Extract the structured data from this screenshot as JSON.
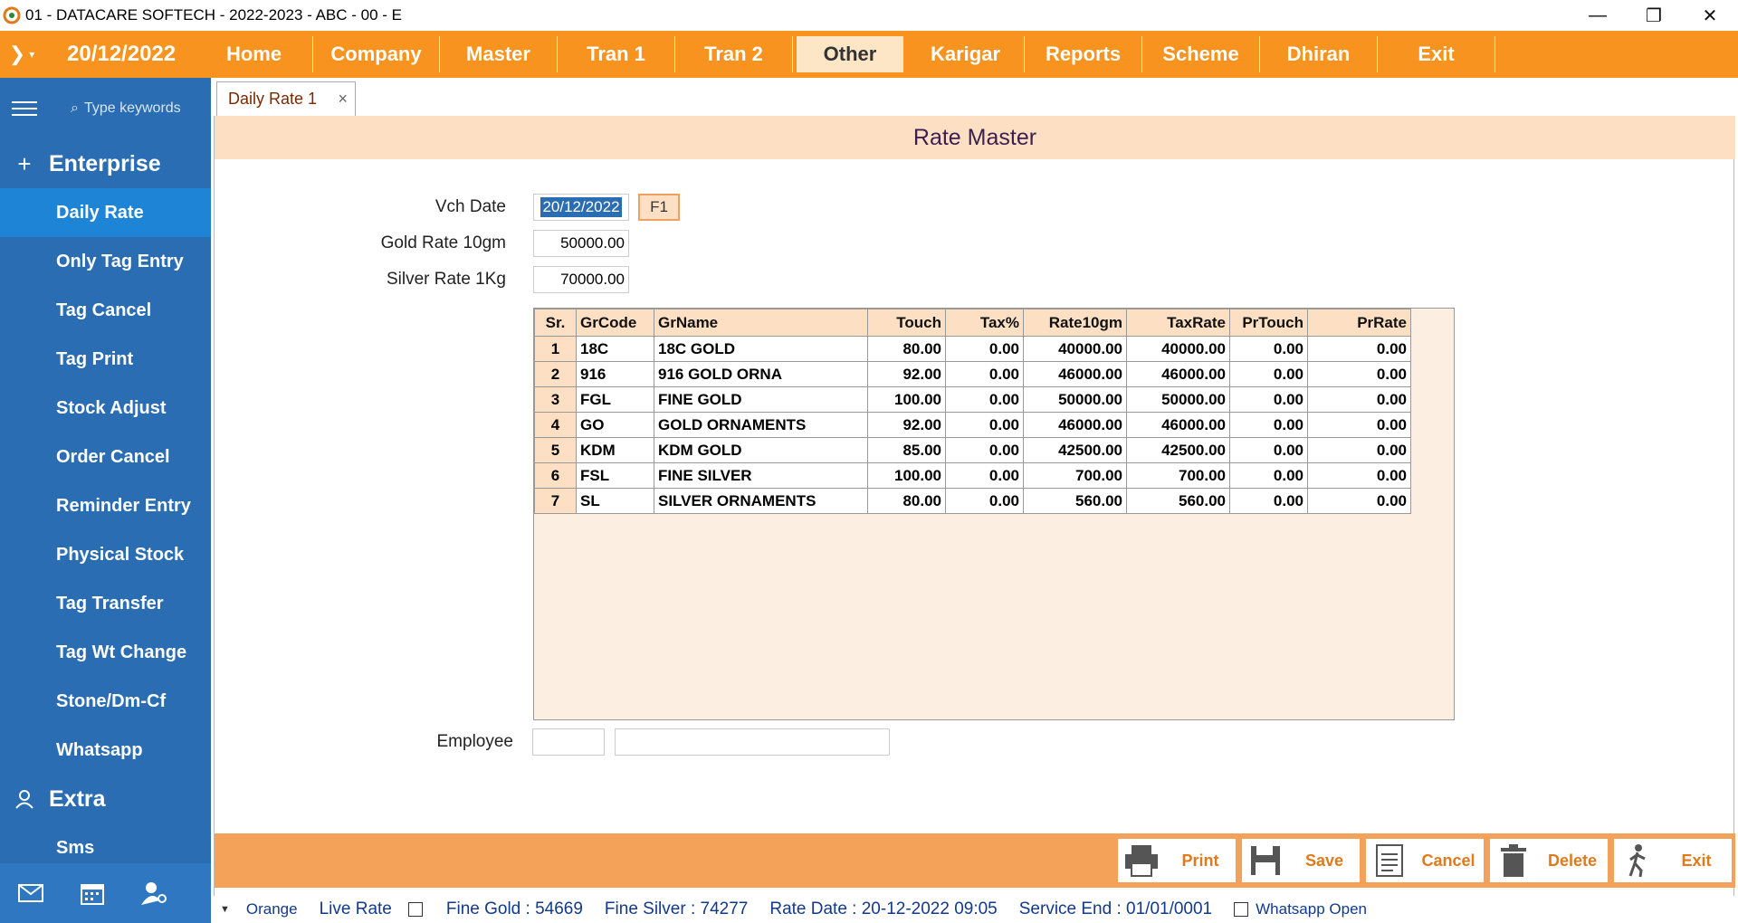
{
  "window": {
    "title": "01 - DATACARE SOFTECH - 2022-2023 - ABC - 00 - E",
    "minimize": "—",
    "restore": "❐",
    "close": "✕"
  },
  "menubar": {
    "date": "20/12/2022",
    "items": [
      "Home",
      "Company",
      "Master",
      "Tran 1",
      "Tran 2",
      "Other",
      "Karigar",
      "Reports",
      "Scheme",
      "Dhiran",
      "Exit"
    ],
    "active": "Other"
  },
  "sidebar": {
    "search_placeholder": "Type keywords",
    "group1": "Enterprise",
    "items": [
      "Daily Rate",
      "Only Tag Entry",
      "Tag Cancel",
      "Tag Print",
      "Stock Adjust",
      "Order Cancel",
      "Reminder Entry",
      "Physical Stock",
      "Tag Transfer",
      "Tag Wt Change",
      "Stone/Dm-Cf",
      "Whatsapp"
    ],
    "active_item": "Daily Rate",
    "group2": "Extra",
    "group2_items": [
      "Sms"
    ]
  },
  "tab": {
    "label": "Daily Rate 1",
    "close": "×"
  },
  "form": {
    "header": "Rate Master",
    "vch_date_label": "Vch Date",
    "vch_date": "20/12/2022",
    "f1_label": "F1",
    "gold_label": "Gold Rate 10gm",
    "gold_value": "50000.00",
    "silver_label": "Silver Rate 1Kg",
    "silver_value": "70000.00",
    "employee_label": "Employee",
    "employee_code": "",
    "employee_name": ""
  },
  "grid": {
    "columns": [
      "Sr.",
      "GrCode",
      "GrName",
      "Touch",
      "Tax%",
      "Rate10gm",
      "TaxRate",
      "PrTouch",
      "PrRate"
    ],
    "rows": [
      [
        "1",
        "18C",
        "18C GOLD",
        "80.00",
        "0.00",
        "40000.00",
        "40000.00",
        "0.00",
        "0.00"
      ],
      [
        "2",
        "916",
        "916 GOLD ORNA",
        "92.00",
        "0.00",
        "46000.00",
        "46000.00",
        "0.00",
        "0.00"
      ],
      [
        "3",
        "FGL",
        "FINE GOLD",
        "100.00",
        "0.00",
        "50000.00",
        "50000.00",
        "0.00",
        "0.00"
      ],
      [
        "4",
        "GO",
        "GOLD ORNAMENTS",
        "92.00",
        "0.00",
        "46000.00",
        "46000.00",
        "0.00",
        "0.00"
      ],
      [
        "5",
        "KDM",
        "KDM GOLD",
        "85.00",
        "0.00",
        "42500.00",
        "42500.00",
        "0.00",
        "0.00"
      ],
      [
        "6",
        "FSL",
        "FINE SILVER",
        "100.00",
        "0.00",
        "700.00",
        "700.00",
        "0.00",
        "0.00"
      ],
      [
        "7",
        "SL",
        "SILVER ORNAMENTS",
        "80.00",
        "0.00",
        "560.00",
        "560.00",
        "0.00",
        "0.00"
      ]
    ]
  },
  "buttons": {
    "print": "Print",
    "save": "Save",
    "cancel": "Cancel",
    "delete": "Delete",
    "exit": "Exit"
  },
  "status": {
    "theme": "Orange",
    "live_rate": "Live Rate",
    "fine_gold": "Fine Gold : 54669",
    "fine_silver": "Fine Silver : 74277",
    "rate_date": "Rate Date : 20-12-2022 09:05",
    "service_end": "Service End :  01/01/0001",
    "whatsapp": "Whatsapp Open"
  },
  "colors": {
    "accent": "#f7931e",
    "sidebar": "#2a6db3",
    "header_bg": "#fde0c4"
  }
}
